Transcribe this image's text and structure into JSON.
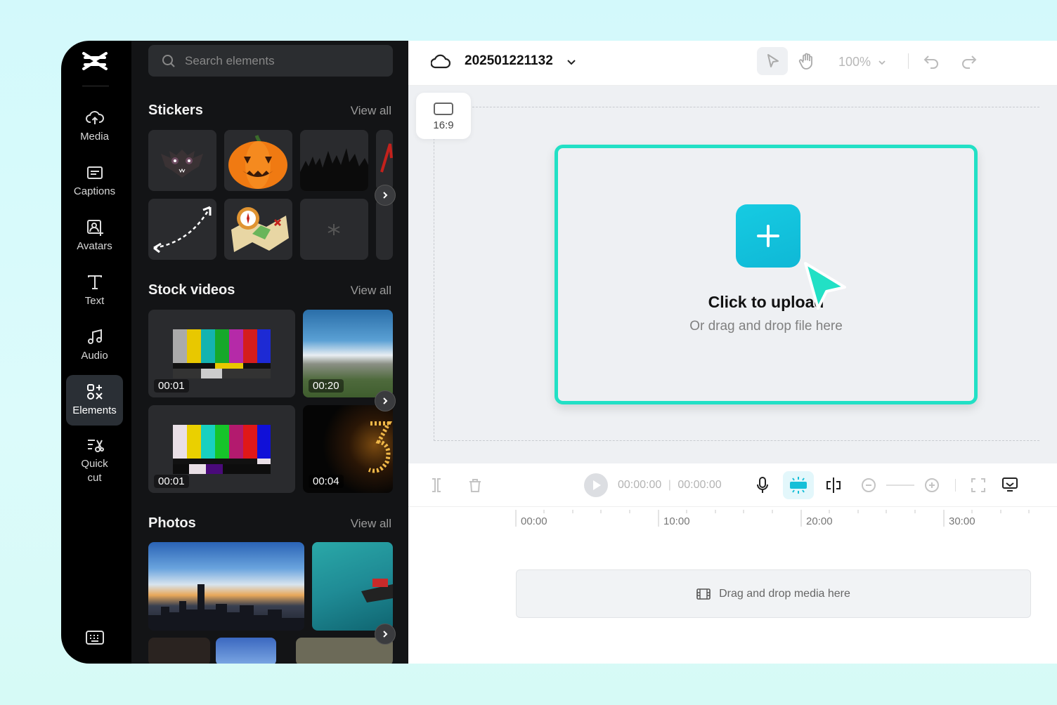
{
  "nav": {
    "items": [
      {
        "label": "Media",
        "icon": "cloud-upload-icon"
      },
      {
        "label": "Captions",
        "icon": "captions-icon"
      },
      {
        "label": "Avatars",
        "icon": "avatar-icon"
      },
      {
        "label": "Text",
        "icon": "text-icon"
      },
      {
        "label": "Audio",
        "icon": "music-icon"
      },
      {
        "label": "Elements",
        "icon": "elements-icon",
        "active": true
      },
      {
        "label": "Quick\ncut",
        "icon": "quick-cut-icon"
      }
    ]
  },
  "panel": {
    "search_placeholder": "Search elements",
    "stickers": {
      "title": "Stickers",
      "view_all": "View all"
    },
    "stock_videos": {
      "title": "Stock videos",
      "view_all": "View all",
      "durations": [
        "00:01",
        "00:20",
        "00:01",
        "00:04"
      ]
    },
    "photos": {
      "title": "Photos",
      "view_all": "View all"
    }
  },
  "topbar": {
    "project_name": "202501221132",
    "zoom": "100%"
  },
  "canvas": {
    "ratio": "16:9",
    "upload_title": "Click to upload",
    "upload_sub": "Or drag and drop file here"
  },
  "playback": {
    "current_time": "00:00:00",
    "total_time": "00:00:00"
  },
  "timeline": {
    "ticks": [
      "00:00",
      "10:00",
      "20:00",
      "30:00"
    ],
    "drop_text": "Drag and drop media here"
  },
  "colors": {
    "accent": "#22e0c5",
    "upload_button": "#16cbe2"
  }
}
